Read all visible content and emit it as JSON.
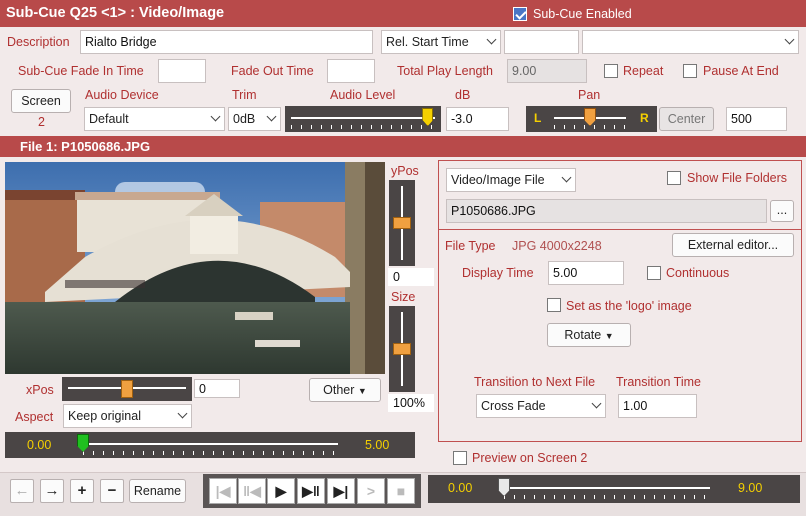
{
  "header": {
    "title": "Sub-Cue Q25 <1> : Video/Image",
    "enabled_label": "Sub-Cue Enabled",
    "enabled": true
  },
  "colors": {
    "header_bg": "#b84a4a",
    "label_red": "#b03030",
    "dark_panel": "#4a4545",
    "audio_thumb": "#f5d000",
    "pan_thumb": "#f0a040",
    "position_thumb": "#20c020"
  },
  "row1": {
    "description_label": "Description",
    "description_value": "Rialto Bridge",
    "start_mode": "Rel. Start Time",
    "start_value": "",
    "extra_value": ""
  },
  "row2": {
    "fade_in_label": "Sub-Cue Fade In Time",
    "fade_in_value": "",
    "fade_out_label": "Fade Out Time",
    "fade_out_value": "",
    "total_label": "Total Play Length",
    "total_value": "9.00",
    "repeat_label": "Repeat",
    "repeat": false,
    "pause_label": "Pause At End",
    "pause": false
  },
  "row3": {
    "screen_label": "Screen",
    "screen_number": "2",
    "audio_device_label": "Audio Device",
    "audio_device": "Default",
    "trim_label": "Trim",
    "trim": "0dB",
    "audio_level_label": "Audio Level",
    "audio_level": 0.95,
    "db_label": "dB",
    "db_value": "-3.0",
    "pan_label": "Pan",
    "pan_left": "L",
    "pan_right": "R",
    "pan_position": 0.5,
    "center_label": "Center",
    "pan_value": "500"
  },
  "file_bar": {
    "title": "File 1: P1050686.JPG"
  },
  "image": {
    "alt": "Photo of the Rialto Bridge in Venice"
  },
  "left": {
    "ypos_label": "yPos",
    "ypos_value": "0",
    "ypos_level": 0.5,
    "size_label": "Size",
    "size_value": "100%",
    "size_level": 0.5,
    "xpos_label": "xPos",
    "xpos_value": "0",
    "xpos_level": 0.5,
    "other_label": "Other",
    "aspect_label": "Aspect",
    "aspect_value": "Keep original",
    "range_start": "0.00",
    "range_end": "5.00",
    "range_level": 0.0
  },
  "right": {
    "type_select": "Video/Image File",
    "show_folders_label": "Show File Folders",
    "show_folders": false,
    "file_name": "P1050686.JPG",
    "browse_label": "...",
    "file_type_label": "File Type",
    "file_type_value": "JPG 4000x2248",
    "external_editor_label": "External editor...",
    "display_time_label": "Display Time",
    "display_time_value": "5.00",
    "continuous_label": "Continuous",
    "continuous": false,
    "logo_label": "Set as the 'logo' image",
    "logo": false,
    "rotate_label": "Rotate",
    "transition_label": "Transition to Next File",
    "transition_time_label": "Transition Time",
    "transition_value": "Cross Fade",
    "transition_time_value": "1.00"
  },
  "preview": {
    "label": "Preview on Screen 2",
    "checked": false
  },
  "bottom": {
    "rename_label": "Rename",
    "time_start": "0.00",
    "time_end": "9.00",
    "time_level": 0.0
  },
  "icons": {
    "move_left": "arrow-left-icon",
    "move_right": "arrow-right-icon",
    "add": "plus-icon",
    "remove": "minus-icon",
    "first": "skip-first-icon",
    "prev": "step-back-icon",
    "play": "play-icon",
    "next": "step-forward-icon",
    "last": "skip-last-icon",
    "fade": "fade-out-icon",
    "stop": "stop-icon"
  }
}
